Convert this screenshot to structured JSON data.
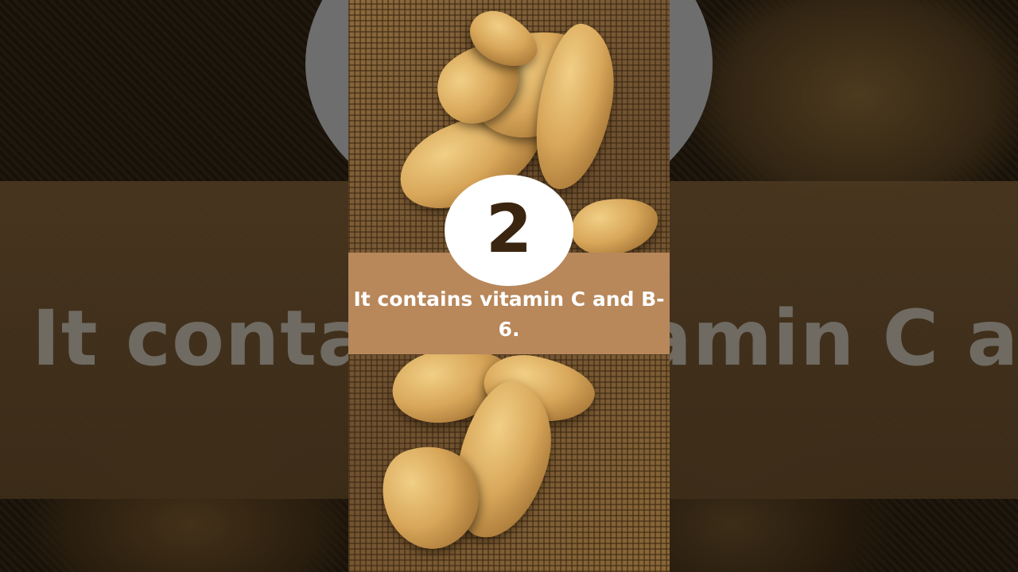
{
  "overlay": {
    "number": "2",
    "caption": "It contains vitamin C and B-6."
  },
  "background": {
    "blurred_caption": "It contains vitamin C and"
  },
  "colors": {
    "caption_band": "#b8875a",
    "number_circle": "#ffffff",
    "number_text": "#3a2510",
    "caption_text": "#ffffff"
  }
}
